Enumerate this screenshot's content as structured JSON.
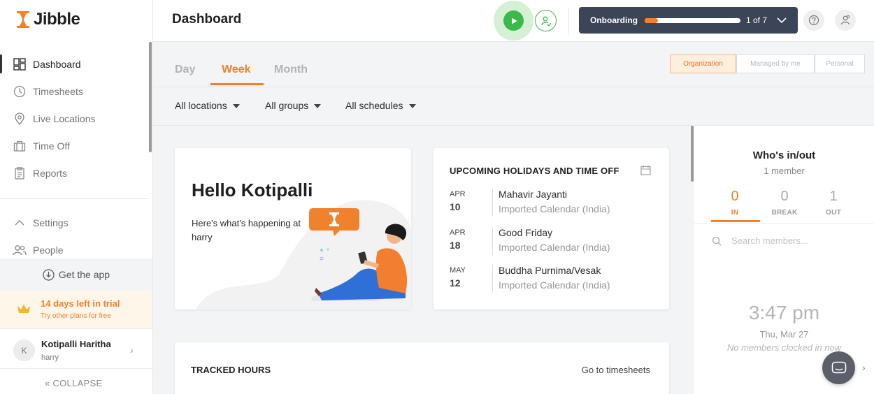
{
  "app": {
    "name": "Jibble"
  },
  "sidebar": {
    "items": [
      {
        "label": "Dashboard",
        "icon": "dashboard-icon"
      },
      {
        "label": "Timesheets",
        "icon": "clock-icon"
      },
      {
        "label": "Live Locations",
        "icon": "location-pin-icon"
      },
      {
        "label": "Time Off",
        "icon": "suitcase-icon"
      },
      {
        "label": "Reports",
        "icon": "report-icon"
      }
    ],
    "secondary": [
      {
        "label": "Settings",
        "icon": "chevron-up-icon"
      },
      {
        "label": "People",
        "icon": "people-icon"
      }
    ],
    "get_app": "Get the app",
    "trial": {
      "title": "14 days left in trial",
      "subtitle": "Try other plans for free"
    },
    "user": {
      "initial": "K",
      "name": "Kotipalli Haritha",
      "handle": "harry"
    },
    "collapse_label": "COLLAPSE"
  },
  "header": {
    "title": "Dashboard",
    "onboarding": {
      "label": "Onboarding",
      "count": "1 of 7",
      "progress": 0.14
    }
  },
  "tabs": {
    "items": [
      "Day",
      "Week",
      "Month"
    ],
    "active": "Week"
  },
  "scope": {
    "items": [
      "Organization",
      "Managed by me",
      "Personal"
    ],
    "active": "Organization"
  },
  "filters": [
    "All locations",
    "All groups",
    "All schedules"
  ],
  "hello": {
    "title": "Hello Kotipalli",
    "subtitle": "Here's what's happening at harry"
  },
  "holidays": {
    "title": "UPCOMING HOLIDAYS AND TIME OFF",
    "items": [
      {
        "month": "APR",
        "day": "10",
        "name": "Mahavir Jayanti",
        "calendar": "Imported Calendar (India)"
      },
      {
        "month": "APR",
        "day": "18",
        "name": "Good Friday",
        "calendar": "Imported Calendar (India)"
      },
      {
        "month": "MAY",
        "day": "12",
        "name": "Buddha Purnima/Vesak",
        "calendar": "Imported Calendar (India)"
      }
    ]
  },
  "tracked": {
    "title": "TRACKED HOURS",
    "link": "Go to timesheets"
  },
  "who": {
    "title": "Who's in/out",
    "subtitle": "1 member",
    "stats": [
      {
        "value": "0",
        "label": "IN"
      },
      {
        "value": "0",
        "label": "BREAK"
      },
      {
        "value": "1",
        "label": "OUT"
      }
    ],
    "search_placeholder": "Search members...",
    "time": "3:47 pm",
    "date": "Thu, Mar 27",
    "message": "No members clocked in now"
  },
  "colors": {
    "accent": "#f0822e",
    "green": "#3cb94a",
    "dark": "#3c4457"
  }
}
